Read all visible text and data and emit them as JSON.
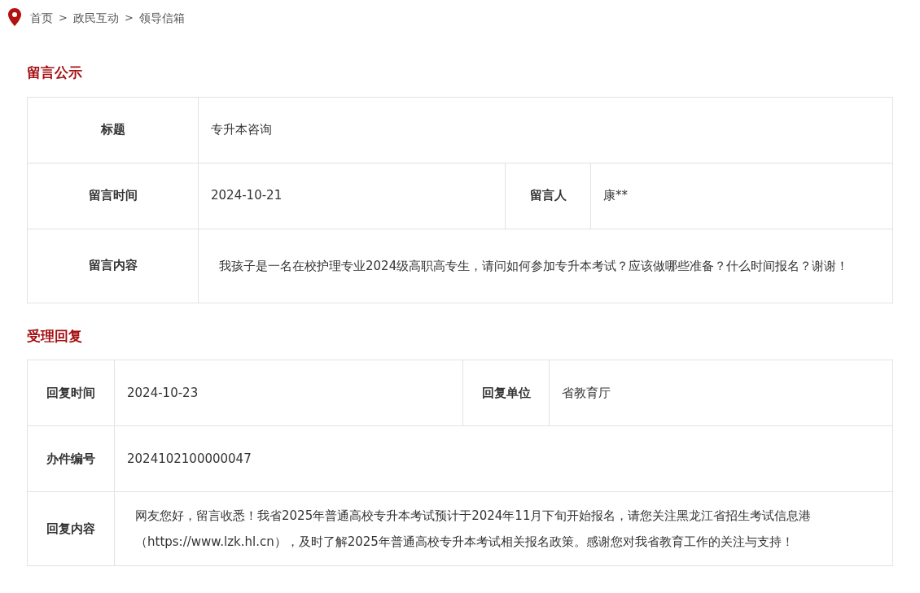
{
  "breadcrumb": [
    {
      "kind": "link",
      "text": "首页"
    },
    {
      "kind": "separator",
      "text": ">"
    },
    {
      "kind": "link",
      "text": "政民互动"
    },
    {
      "kind": "separator",
      "text": ">"
    },
    {
      "kind": "link",
      "text": "领导信箱"
    }
  ],
  "sections": [
    {
      "title": "留言公示",
      "rows": [
        {
          "kind": "single",
          "cells": [
            {
              "kind": "label",
              "text": "标题"
            },
            {
              "kind": "value",
              "text": "专升本咨询"
            }
          ]
        },
        {
          "kind": "double",
          "cells": [
            {
              "kind": "label",
              "text": "留言时间"
            },
            {
              "kind": "value",
              "text": "2024-10-21"
            },
            {
              "kind": "label",
              "text": "留言人"
            },
            {
              "kind": "value",
              "text": "康**"
            }
          ]
        },
        {
          "kind": "content",
          "cells": [
            {
              "kind": "label",
              "text": "留言内容"
            },
            {
              "kind": "value",
              "text": "我孩子是一名在校护理专业2024级高职高专生，请问如何参加专升本考试？应该做哪些准备？什么时间报名？谢谢！"
            }
          ]
        }
      ]
    },
    {
      "title": "受理回复",
      "rows": [
        {
          "kind": "double",
          "cells": [
            {
              "kind": "label",
              "text": "回复时间"
            },
            {
              "kind": "value",
              "text": "2024-10-23"
            },
            {
              "kind": "label",
              "text": "回复单位"
            },
            {
              "kind": "value",
              "text": "省教育厅"
            }
          ]
        },
        {
          "kind": "single",
          "cells": [
            {
              "kind": "label",
              "text": "办件编号"
            },
            {
              "kind": "value",
              "text": "2024102100000047"
            }
          ]
        },
        {
          "kind": "content",
          "cells": [
            {
              "kind": "label",
              "text": "回复内容"
            },
            {
              "kind": "value",
              "text": "网友您好，留言收悉！我省2025年普通高校专升本考试预计于2024年11月下旬开始报名，请您关注黑龙江省招生考试信息港（https://www.lzk.hl.cn），及时了解2025年普通高校专升本考试相关报名政策。感谢您对我省教育工作的关注与支持！"
            }
          ]
        }
      ]
    }
  ]
}
